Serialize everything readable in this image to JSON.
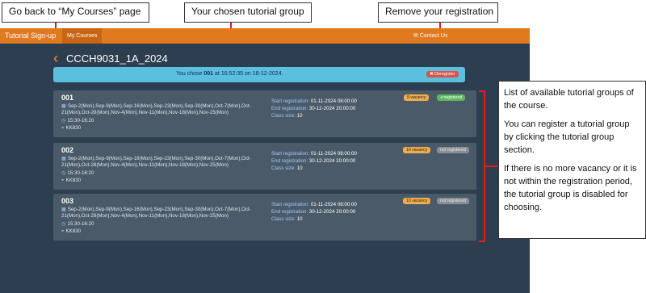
{
  "callouts": {
    "back": "Go back to “My Courses” page",
    "group": "Your chosen tutorial group",
    "remove": "Remove your registration"
  },
  "topbar": {
    "brand": "Tutorial Sign-up",
    "my_courses": "My Courses",
    "contact": "Contact Us"
  },
  "course": {
    "title": "CCCH9031_1A_2024"
  },
  "chosen": {
    "prefix": "You chose",
    "group": "001",
    "mid": "at",
    "time": "16:52:35",
    "on": "on",
    "date": "18-12-2024.",
    "deregister": "Deregister"
  },
  "labels": {
    "start": "Start registration:",
    "end": "End registration:",
    "size": "Class size:"
  },
  "groups": [
    {
      "code": "001",
      "dates": "Sep-2(Mon),Sep-9(Mon),Sep-16(Mon),Sep-23(Mon),Sep-30(Mon),Oct-7(Mon),Oct-21(Mon),Oct-28(Mon),Nov-4(Mon),Nov-11(Mon),Nov-18(Mon),Nov-25(Mon)",
      "time": "15:30-16:20",
      "room": "KK830",
      "start": "01-11-2024 08:00:00",
      "end": "30-12-2024 20:00:00",
      "size": "10",
      "vacancy": "9 vacancy",
      "status": "registered"
    },
    {
      "code": "002",
      "dates": "Sep-2(Mon),Sep-9(Mon),Sep-16(Mon),Sep-23(Mon),Sep-30(Mon),Oct-7(Mon),Oct-21(Mon),Oct-28(Mon),Nov-4(Mon),Nov-11(Mon),Nov-18(Mon),Nov-25(Mon)",
      "time": "15:30-16:20",
      "room": "KK830",
      "start": "01-11-2024 08:00:00",
      "end": "30-12-2024 20:00:00",
      "size": "10",
      "vacancy": "10 vacancy",
      "status": "not registered"
    },
    {
      "code": "003",
      "dates": "Sep-2(Mon),Sep-9(Mon),Sep-16(Mon),Sep-23(Mon),Sep-30(Mon),Oct-7(Mon),Oct-21(Mon),Oct-28(Mon),Nov-4(Mon),Nov-11(Mon),Nov-18(Mon),Nov-25(Mon)",
      "time": "15:30-16:20",
      "room": "KK830",
      "start": "01-11-2024 08:00:00",
      "end": "30-12-2024 20:00:00",
      "size": "10",
      "vacancy": "10 vacancy",
      "status": "not registered"
    }
  ],
  "note": {
    "p1": "List of available tutorial groups of the course.",
    "p2": "You can register a tutorial group by clicking the tutorial group section.",
    "p3": "If there is no more vacancy or it is not within the registration period, the tutorial group is disabled for choosing."
  }
}
